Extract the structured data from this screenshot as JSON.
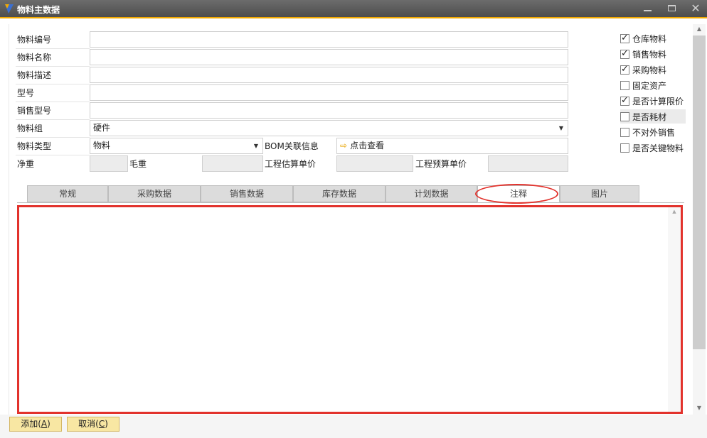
{
  "window": {
    "title": "物料主数据",
    "minimize_icon": "minimize-icon",
    "maximize_icon": "maximize-icon",
    "close_icon": "close-icon",
    "close_glyph": "✕"
  },
  "form": {
    "item_code": {
      "label": "物料编号",
      "value": ""
    },
    "item_name": {
      "label": "物料名称",
      "value": ""
    },
    "item_desc": {
      "label": "物料描述",
      "value": ""
    },
    "model": {
      "label": "型号",
      "value": ""
    },
    "sales_model": {
      "label": "销售型号",
      "value": ""
    },
    "item_group": {
      "label": "物料组",
      "value": "硬件"
    },
    "item_type": {
      "label": "物料类型",
      "value": "物料"
    },
    "bom_info": {
      "label": "BOM关联信息",
      "link_text": "点击查看",
      "link_icon": "arrow-right-icon",
      "link_glyph": "⇨"
    },
    "net_weight": {
      "label": "净重",
      "value": ""
    },
    "gross_weight": {
      "label": "毛重",
      "value": ""
    },
    "est_price": {
      "label": "工程估算单价",
      "value": ""
    },
    "budget_price": {
      "label": "工程预算单价",
      "value": ""
    }
  },
  "checkboxes": [
    {
      "label": "仓库物料",
      "checked": true
    },
    {
      "label": "销售物料",
      "checked": true
    },
    {
      "label": "采购物料",
      "checked": true
    },
    {
      "label": "固定资产",
      "checked": false
    },
    {
      "label": "是否计算限价",
      "checked": true
    },
    {
      "label": "是否耗材",
      "checked": false
    },
    {
      "label": "不对外销售",
      "checked": false
    },
    {
      "label": "是否关键物料",
      "checked": false
    }
  ],
  "tabs": [
    {
      "label": "常规"
    },
    {
      "label": "采购数据"
    },
    {
      "label": "销售数据"
    },
    {
      "label": "库存数据"
    },
    {
      "label": "计划数据"
    },
    {
      "label": "注释",
      "active": true
    },
    {
      "label": "图片"
    }
  ],
  "notes": {
    "value": ""
  },
  "buttons": {
    "add": {
      "label": "添加",
      "hotkey": "(A)",
      "hotkey_prefix": "(",
      "hotkey_letter": "A",
      "hotkey_suffix": ")"
    },
    "cancel": {
      "label": "取消",
      "hotkey": "(C)",
      "hotkey_prefix": "(",
      "hotkey_letter": "C",
      "hotkey_suffix": ")"
    }
  },
  "colors": {
    "title_accent": "#f2a900",
    "highlight_red": "#e2322c",
    "button_fill": "#f8e7a3"
  }
}
